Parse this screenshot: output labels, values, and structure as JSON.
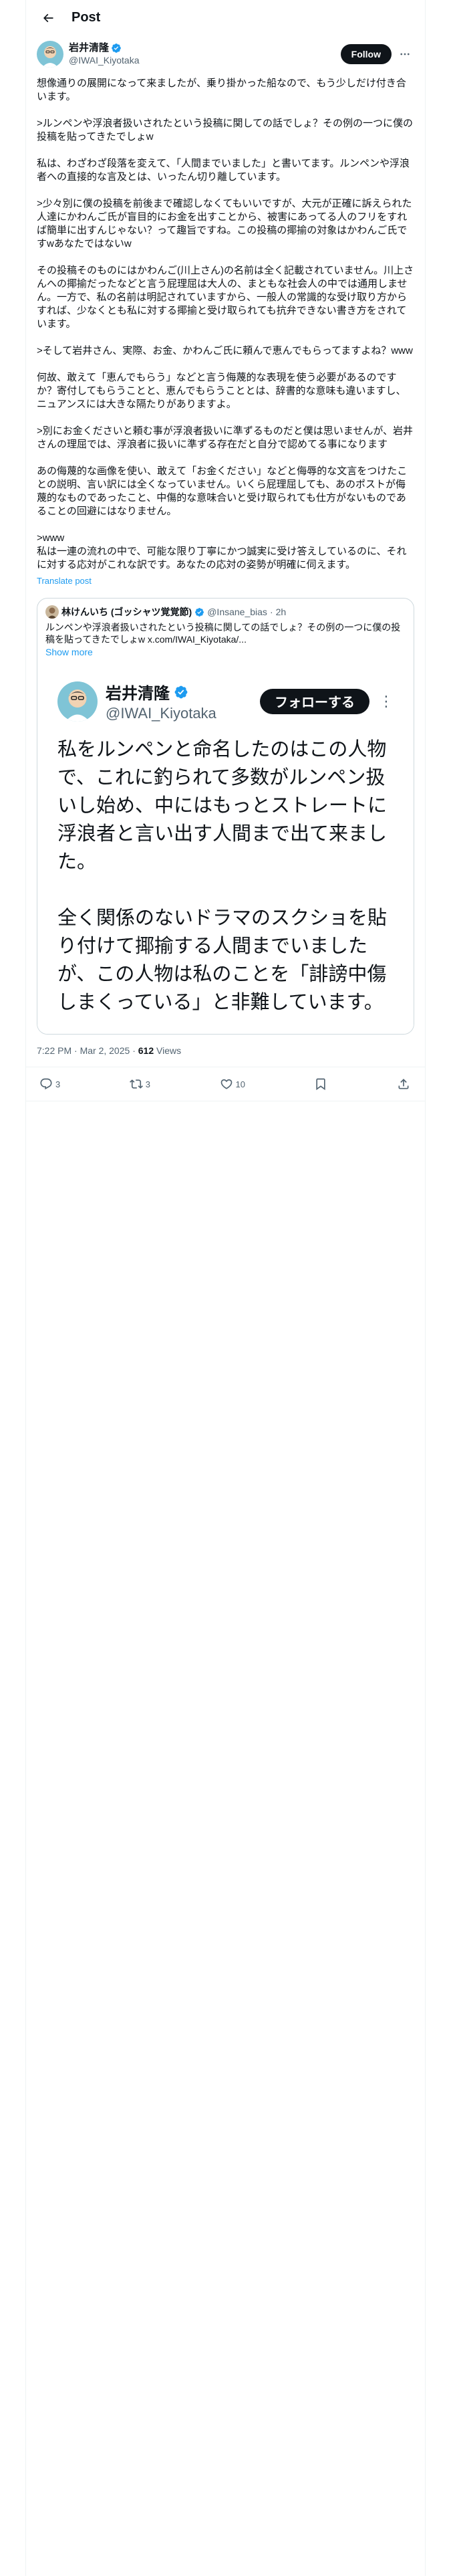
{
  "header": {
    "title": "Post"
  },
  "author": {
    "name": "岩井清隆",
    "handle": "@IWAI_Kiyotaka",
    "follow_label": "Follow"
  },
  "post": {
    "text": "想像通りの展開になって来ましたが、乗り掛かった船なので、もう少しだけ付き合います。\n\n>ルンペンや浮浪者扱いされたという投稿に関しての話でしょ？その例の一つに僕の投稿を貼ってきたでしょw\n\n私は、わざわざ段落を変えて、「人間までいました」と書いてます。ルンペンや浮浪者への直接的な言及とは、いったん切り離しています。\n\n>少々別に僕の投稿を前後まで確認しなくてもいいですが、大元が正確に訴えられた人達にかわんご氏が盲目的にお金を出すことから、被害にあってる人のフリをすれば簡単に出すんじゃない？って趣旨ですね。この投稿の揶揄の対象はかわんご氏ですwあなたではないw\n\nその投稿そのものにはかわんご(川上さん)の名前は全く記載されていません。川上さんへの揶揄だったなどと言う屁理屈は大人の、まともな社会人の中では通用しません。一方で、私の名前は明記されていますから、一般人の常識的な受け取り方からすれば、少なくとも私に対する揶揄と受け取られても抗弁できない書き方をされています。\n\n>そして岩井さん、実際、お金、かわんご氏に頼んで恵んでもらってますよね？www\n\n何故、敢えて「恵んでもらう」などと言う侮蔑的な表現を使う必要があるのですか？寄付してもらうことと、恵んでもらうこととは、辞書的な意味も違いますし、ニュアンスには大きな隔たりがありますよ。\n\n>別にお金くださいと頼む事が浮浪者扱いに準ずるものだと僕は思いませんが、岩井さんの理屈では、浮浪者に扱いに準ずる存在だと自分で認めてる事になります\n\nあの侮蔑的な画像を使い、敢えて「お金ください」などと侮辱的な文言をつけたことの説明、言い訳には全くなっていません。いくら屁理屈しても、あのポストが侮蔑的なものであったこと、中傷的な意味合いと受け取られても仕方がないものであることの回避にはなりません。\n\n>www\n私は一連の流れの中で、可能な限り丁寧にかつ誠実に受け答えしているのに、それに対する応対がこれな訳です。あなたの応対の姿勢が明確に伺えます。",
    "translate_label": "Translate post",
    "timestamp": "7:22 PM · Mar 2, 2025",
    "views_count": "612",
    "views_label": "Views"
  },
  "quote": {
    "name": "林けんいち (ゴッシャツ覚覚節)",
    "handle": "@Insane_bias",
    "separator": "·",
    "time": "2h",
    "text": "ルンペンや浮浪者扱いされたという投稿に関しての話でしょ？その例の一つに僕の投稿を貼ってきたでしょw x.com/IWAI_Kiyotaka/...",
    "show_more": "Show more",
    "image": {
      "name": "岩井清隆",
      "handle": "@IWAI_Kiyotaka",
      "follow_label": "フォローする",
      "body": "私をルンペンと命名したのはこの人物で、これに釣られて多数がルンペン扱いし始め、中にはもっとストレートに浮浪者と言い出す人間まで出て来ました。\n\n全く関係のないドラマのスクショを貼り付けて揶揄する人間までいましたが、この人物は私のことを「誹謗中傷しまくっている」と非難しています。"
    }
  },
  "actions": {
    "replies": "3",
    "reposts": "3",
    "likes": "10"
  },
  "colors": {
    "accent": "#1d9bf0",
    "text": "#0f1419",
    "muted": "#536471",
    "border": "#eff3f4"
  },
  "icons": [
    "back-arrow-icon",
    "verified-badge-icon",
    "more-icon",
    "reply-icon",
    "repost-icon",
    "like-icon",
    "bookmark-icon",
    "share-icon"
  ]
}
